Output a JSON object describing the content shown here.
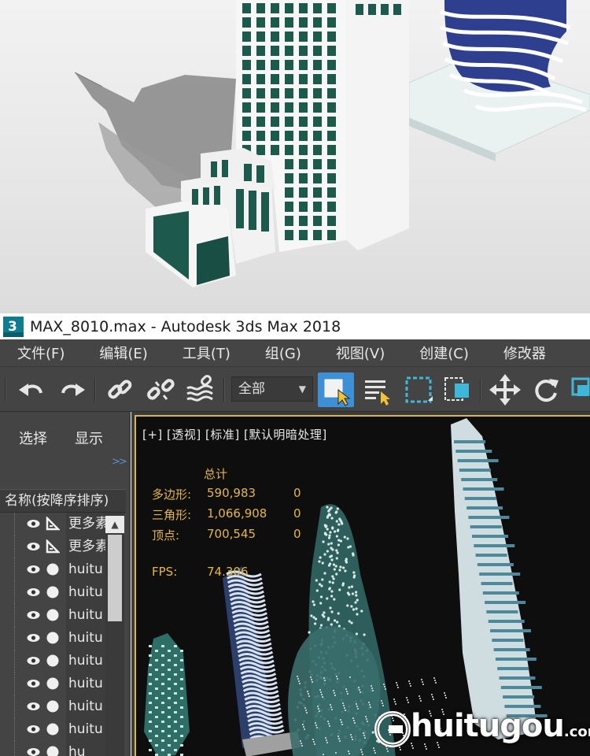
{
  "window": {
    "title": "MAX_8010.max - Autodesk 3ds Max 2018",
    "logo_text": "3"
  },
  "menu": [
    {
      "label": "文件(F)"
    },
    {
      "label": "编辑(E)"
    },
    {
      "label": "工具(T)"
    },
    {
      "label": "组(G)"
    },
    {
      "label": "视图(V)"
    },
    {
      "label": "创建(C)"
    },
    {
      "label": "修改器"
    }
  ],
  "toolbar": {
    "filter": {
      "value": "全部"
    },
    "icons": [
      "undo-icon",
      "redo-icon",
      "link-icon",
      "unlink-icon",
      "bind-spacewarp-icon",
      "select-object-icon",
      "select-by-name-icon",
      "rect-selection-icon",
      "window-crossing-icon",
      "move-icon",
      "rotate-icon",
      "scale-icon"
    ]
  },
  "explorer": {
    "tabs": [
      "选择",
      "显示"
    ],
    "column_header": "名称(按降序排序)",
    "rows": [
      {
        "label": "更多素",
        "type": "layer"
      },
      {
        "label": "更多素",
        "type": "layer"
      },
      {
        "label": "huitu",
        "type": "object"
      },
      {
        "label": "huitu",
        "type": "object"
      },
      {
        "label": "huitu",
        "type": "object"
      },
      {
        "label": "huitu",
        "type": "object"
      },
      {
        "label": "huitu",
        "type": "object"
      },
      {
        "label": "huitu",
        "type": "object"
      },
      {
        "label": "huitu",
        "type": "object"
      },
      {
        "label": "huitu",
        "type": "object"
      },
      {
        "label": "hu",
        "type": "object"
      }
    ]
  },
  "viewport": {
    "label": "[+] [透视] [标准] [默认明暗处理]",
    "stats": {
      "header": "总计",
      "polygons_label": "多边形:",
      "polygons": "590,983",
      "polygons_sel": "0",
      "triangles_label": "三角形:",
      "triangles": "1,066,908",
      "triangles_sel": "0",
      "vertices_label": "顶点:",
      "vertices": "700,545",
      "vertices_sel": "0",
      "fps_label": "FPS:",
      "fps": "74.306"
    }
  },
  "watermark": {
    "text": "huitugou",
    "suffix": ".com"
  },
  "colors": {
    "accent": "#d9b64a",
    "stats": "#e6b83a",
    "menubar": "#454545",
    "selection_blue": "#3d8fd6"
  }
}
